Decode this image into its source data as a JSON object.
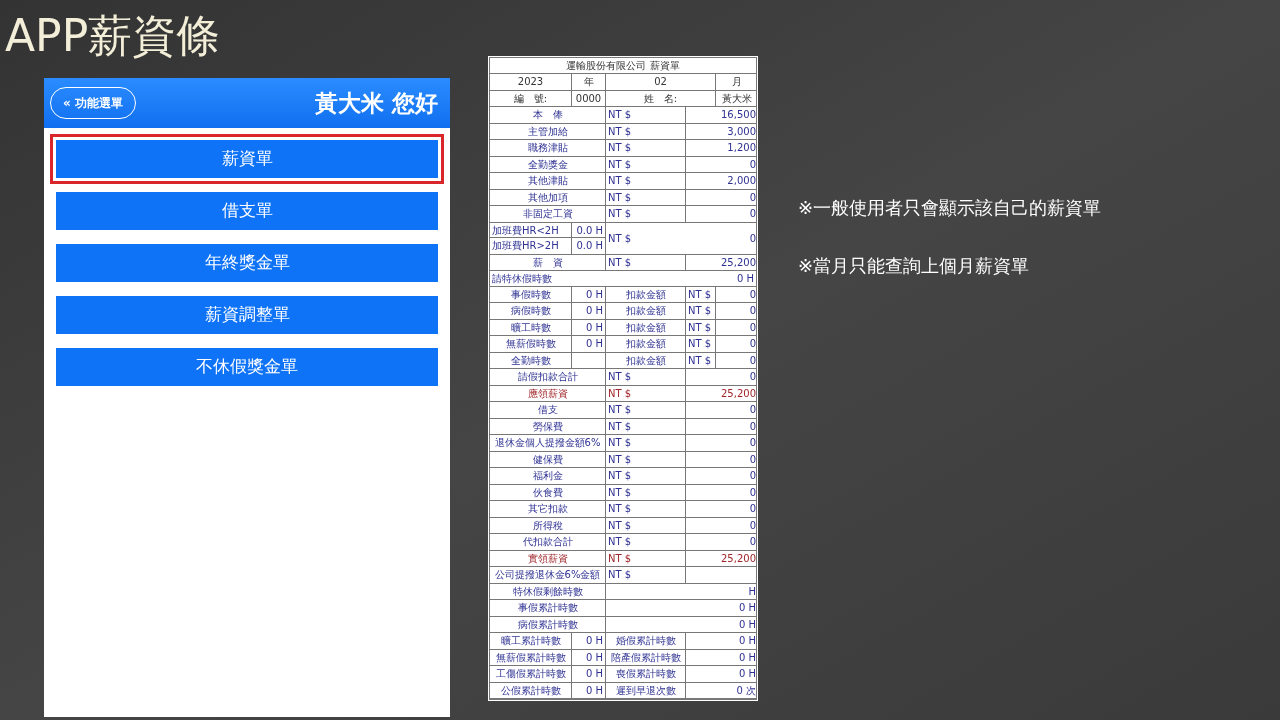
{
  "slide_title": "APP薪資條",
  "app": {
    "back_button": "« 功能選單",
    "greeting": "黃大米 您好",
    "menu": [
      {
        "label": "薪資單",
        "selected": true
      },
      {
        "label": "借支單",
        "selected": false
      },
      {
        "label": "年終獎金單",
        "selected": false
      },
      {
        "label": "薪資調整單",
        "selected": false
      },
      {
        "label": "不休假獎金單",
        "selected": false
      }
    ]
  },
  "payslip": {
    "title": "運輸股份有限公司 薪資單",
    "rows": [
      {
        "kind": "header",
        "cells": [
          "2023",
          "年",
          "02",
          "月"
        ]
      },
      {
        "kind": "header",
        "cells": [
          "編　號:",
          "0000",
          "姓　名:",
          "黃大米"
        ]
      },
      {
        "kind": "amount",
        "label": "本　俸",
        "currency": "NT $",
        "amount": "16,500",
        "highlight": false
      },
      {
        "kind": "amount",
        "label": "主管加給",
        "currency": "NT $",
        "amount": "3,000",
        "highlight": false
      },
      {
        "kind": "amount",
        "label": "職務津貼",
        "currency": "NT $",
        "amount": "1,200",
        "highlight": false
      },
      {
        "kind": "amount",
        "label": "全勤獎金",
        "currency": "NT $",
        "amount": "0",
        "highlight": false
      },
      {
        "kind": "amount",
        "label": "其他津貼",
        "currency": "NT $",
        "amount": "2,000",
        "highlight": false
      },
      {
        "kind": "amount",
        "label": "其他加項",
        "currency": "NT $",
        "amount": "0",
        "highlight": false
      },
      {
        "kind": "amount",
        "label": "非固定工資",
        "currency": "NT $",
        "amount": "0",
        "highlight": false
      },
      {
        "kind": "overtime",
        "items": [
          {
            "label": "加班費HR<2H",
            "hours": "0.0 H"
          },
          {
            "label": "加班費HR>2H",
            "hours": "0.0 H"
          }
        ],
        "currency": "NT $",
        "amount": "0"
      },
      {
        "kind": "amount",
        "label": "薪　資",
        "currency": "NT $",
        "amount": "25,200",
        "highlight": false
      },
      {
        "kind": "summary",
        "label": "請特休假時數",
        "value": "0 H"
      },
      {
        "kind": "leave",
        "label": "事假時數",
        "hours": "0 H",
        "deduction_label": "扣款金額",
        "currency": "NT $",
        "amount": "0"
      },
      {
        "kind": "leave",
        "label": "病假時數",
        "hours": "0 H",
        "deduction_label": "扣款金額",
        "currency": "NT $",
        "amount": "0"
      },
      {
        "kind": "leave",
        "label": "曠工時數",
        "hours": "0 H",
        "deduction_label": "扣款金額",
        "currency": "NT $",
        "amount": "0"
      },
      {
        "kind": "leave",
        "label": "無薪假時數",
        "hours": "0 H",
        "deduction_label": "扣款金額",
        "currency": "NT $",
        "amount": "0"
      },
      {
        "kind": "leave",
        "label": "全勤時數",
        "deduction_label": "扣款金額",
        "currency": "NT $",
        "amount": "0"
      },
      {
        "kind": "amount",
        "label": "請假扣款合計",
        "currency": "NT $",
        "amount": "0",
        "highlight": false
      },
      {
        "kind": "amount",
        "label": "應領薪資",
        "currency": "NT $",
        "amount": "25,200",
        "highlight": true
      },
      {
        "kind": "amount",
        "label": "借支",
        "currency": "NT $",
        "amount": "0",
        "highlight": false
      },
      {
        "kind": "amount",
        "label": "勞保費",
        "currency": "NT $",
        "amount": "0",
        "highlight": false
      },
      {
        "kind": "amount",
        "label": "退休金個人提撥金額6%",
        "currency": "NT $",
        "amount": "0",
        "highlight": false
      },
      {
        "kind": "amount",
        "label": "健保費",
        "currency": "NT $",
        "amount": "0",
        "highlight": false
      },
      {
        "kind": "amount",
        "label": "福利金",
        "currency": "NT $",
        "amount": "0",
        "highlight": false
      },
      {
        "kind": "amount",
        "label": "伙食費",
        "currency": "NT $",
        "amount": "0",
        "highlight": false
      },
      {
        "kind": "amount",
        "label": "其它扣款",
        "currency": "NT $",
        "amount": "0",
        "highlight": false
      },
      {
        "kind": "amount",
        "label": "所得稅",
        "currency": "NT $",
        "amount": "0",
        "highlight": false
      },
      {
        "kind": "amount",
        "label": "代扣款合計",
        "currency": "NT $",
        "amount": "0",
        "highlight": false
      },
      {
        "kind": "amount",
        "label": "實領薪資",
        "currency": "NT $",
        "amount": "25,200",
        "highlight": true
      },
      {
        "kind": "amount",
        "label": "公司提撥退休金6%金額",
        "currency": "NT $",
        "highlight": false
      },
      {
        "kind": "total",
        "label": "特休假剩餘時數",
        "value": "H"
      },
      {
        "kind": "total",
        "label": "事假累計時數",
        "value": "0 H"
      },
      {
        "kind": "total",
        "label": "病假累計時數",
        "value": "0 H"
      },
      {
        "kind": "pair",
        "cells": [
          "曠工累計時數",
          "0 H",
          "婚假累計時數",
          "0 H"
        ]
      },
      {
        "kind": "pair",
        "cells": [
          "無薪假累計時數",
          "0 H",
          "陪產假累計時數",
          "0 H"
        ]
      },
      {
        "kind": "pair",
        "cells": [
          "工傷假累計時數",
          "0 H",
          "喪假累計時數",
          "0 H"
        ]
      },
      {
        "kind": "pair",
        "cells": [
          "公假累計時數",
          "0 H",
          "遲到早退次數",
          "0 次"
        ]
      }
    ]
  },
  "notes": [
    "※一般使用者只會顯示該自己的薪資單",
    "※當月只能查詢上個月薪資單"
  ]
}
